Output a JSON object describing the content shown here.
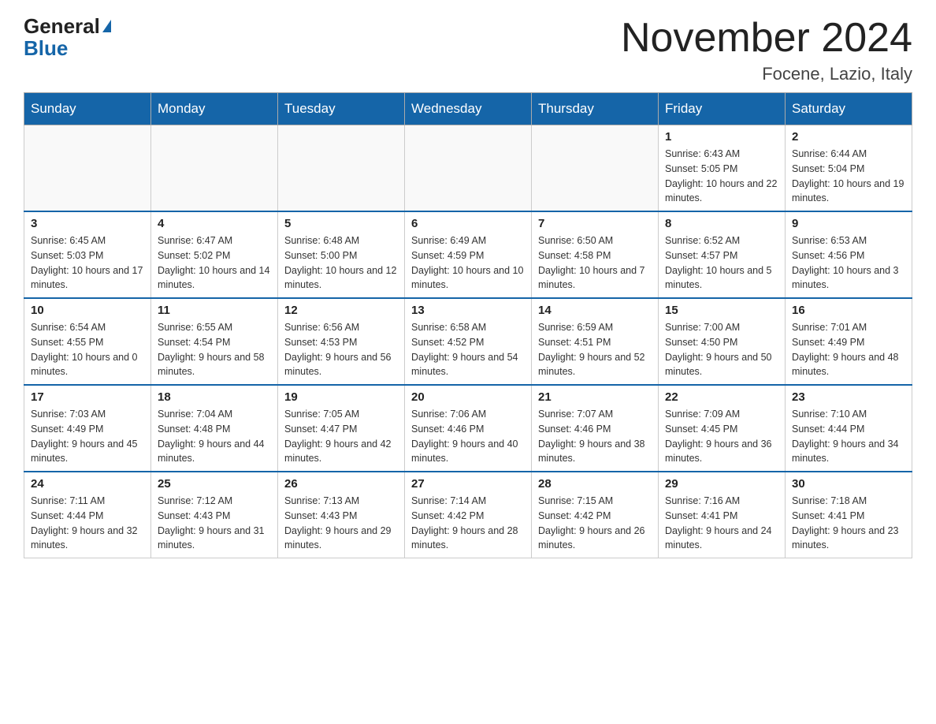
{
  "header": {
    "logo_general": "General",
    "logo_blue": "Blue",
    "month_title": "November 2024",
    "location": "Focene, Lazio, Italy"
  },
  "weekdays": [
    "Sunday",
    "Monday",
    "Tuesday",
    "Wednesday",
    "Thursday",
    "Friday",
    "Saturday"
  ],
  "weeks": [
    [
      {
        "day": "",
        "info": ""
      },
      {
        "day": "",
        "info": ""
      },
      {
        "day": "",
        "info": ""
      },
      {
        "day": "",
        "info": ""
      },
      {
        "day": "",
        "info": ""
      },
      {
        "day": "1",
        "info": "Sunrise: 6:43 AM\nSunset: 5:05 PM\nDaylight: 10 hours and 22 minutes."
      },
      {
        "day": "2",
        "info": "Sunrise: 6:44 AM\nSunset: 5:04 PM\nDaylight: 10 hours and 19 minutes."
      }
    ],
    [
      {
        "day": "3",
        "info": "Sunrise: 6:45 AM\nSunset: 5:03 PM\nDaylight: 10 hours and 17 minutes."
      },
      {
        "day": "4",
        "info": "Sunrise: 6:47 AM\nSunset: 5:02 PM\nDaylight: 10 hours and 14 minutes."
      },
      {
        "day": "5",
        "info": "Sunrise: 6:48 AM\nSunset: 5:00 PM\nDaylight: 10 hours and 12 minutes."
      },
      {
        "day": "6",
        "info": "Sunrise: 6:49 AM\nSunset: 4:59 PM\nDaylight: 10 hours and 10 minutes."
      },
      {
        "day": "7",
        "info": "Sunrise: 6:50 AM\nSunset: 4:58 PM\nDaylight: 10 hours and 7 minutes."
      },
      {
        "day": "8",
        "info": "Sunrise: 6:52 AM\nSunset: 4:57 PM\nDaylight: 10 hours and 5 minutes."
      },
      {
        "day": "9",
        "info": "Sunrise: 6:53 AM\nSunset: 4:56 PM\nDaylight: 10 hours and 3 minutes."
      }
    ],
    [
      {
        "day": "10",
        "info": "Sunrise: 6:54 AM\nSunset: 4:55 PM\nDaylight: 10 hours and 0 minutes."
      },
      {
        "day": "11",
        "info": "Sunrise: 6:55 AM\nSunset: 4:54 PM\nDaylight: 9 hours and 58 minutes."
      },
      {
        "day": "12",
        "info": "Sunrise: 6:56 AM\nSunset: 4:53 PM\nDaylight: 9 hours and 56 minutes."
      },
      {
        "day": "13",
        "info": "Sunrise: 6:58 AM\nSunset: 4:52 PM\nDaylight: 9 hours and 54 minutes."
      },
      {
        "day": "14",
        "info": "Sunrise: 6:59 AM\nSunset: 4:51 PM\nDaylight: 9 hours and 52 minutes."
      },
      {
        "day": "15",
        "info": "Sunrise: 7:00 AM\nSunset: 4:50 PM\nDaylight: 9 hours and 50 minutes."
      },
      {
        "day": "16",
        "info": "Sunrise: 7:01 AM\nSunset: 4:49 PM\nDaylight: 9 hours and 48 minutes."
      }
    ],
    [
      {
        "day": "17",
        "info": "Sunrise: 7:03 AM\nSunset: 4:49 PM\nDaylight: 9 hours and 45 minutes."
      },
      {
        "day": "18",
        "info": "Sunrise: 7:04 AM\nSunset: 4:48 PM\nDaylight: 9 hours and 44 minutes."
      },
      {
        "day": "19",
        "info": "Sunrise: 7:05 AM\nSunset: 4:47 PM\nDaylight: 9 hours and 42 minutes."
      },
      {
        "day": "20",
        "info": "Sunrise: 7:06 AM\nSunset: 4:46 PM\nDaylight: 9 hours and 40 minutes."
      },
      {
        "day": "21",
        "info": "Sunrise: 7:07 AM\nSunset: 4:46 PM\nDaylight: 9 hours and 38 minutes."
      },
      {
        "day": "22",
        "info": "Sunrise: 7:09 AM\nSunset: 4:45 PM\nDaylight: 9 hours and 36 minutes."
      },
      {
        "day": "23",
        "info": "Sunrise: 7:10 AM\nSunset: 4:44 PM\nDaylight: 9 hours and 34 minutes."
      }
    ],
    [
      {
        "day": "24",
        "info": "Sunrise: 7:11 AM\nSunset: 4:44 PM\nDaylight: 9 hours and 32 minutes."
      },
      {
        "day": "25",
        "info": "Sunrise: 7:12 AM\nSunset: 4:43 PM\nDaylight: 9 hours and 31 minutes."
      },
      {
        "day": "26",
        "info": "Sunrise: 7:13 AM\nSunset: 4:43 PM\nDaylight: 9 hours and 29 minutes."
      },
      {
        "day": "27",
        "info": "Sunrise: 7:14 AM\nSunset: 4:42 PM\nDaylight: 9 hours and 28 minutes."
      },
      {
        "day": "28",
        "info": "Sunrise: 7:15 AM\nSunset: 4:42 PM\nDaylight: 9 hours and 26 minutes."
      },
      {
        "day": "29",
        "info": "Sunrise: 7:16 AM\nSunset: 4:41 PM\nDaylight: 9 hours and 24 minutes."
      },
      {
        "day": "30",
        "info": "Sunrise: 7:18 AM\nSunset: 4:41 PM\nDaylight: 9 hours and 23 minutes."
      }
    ]
  ]
}
